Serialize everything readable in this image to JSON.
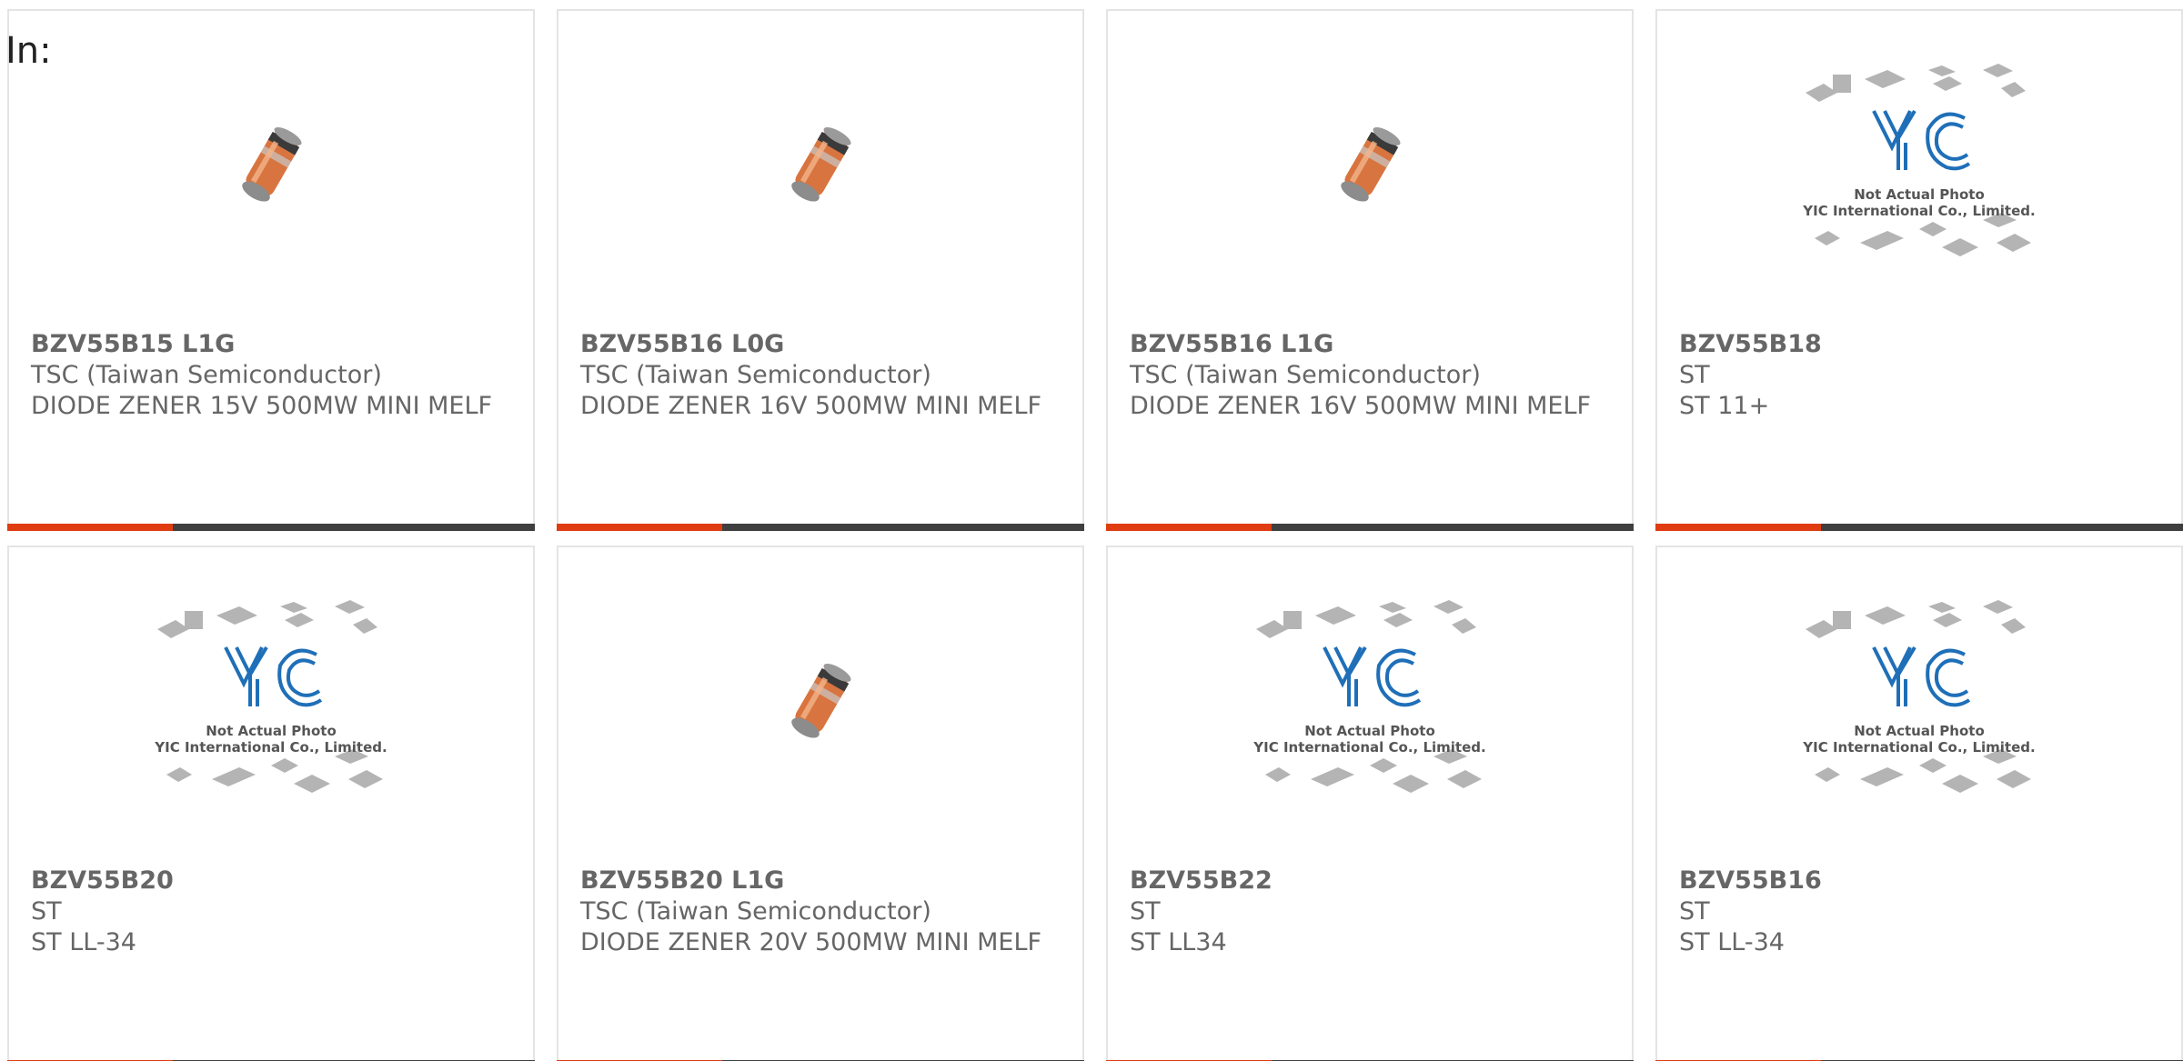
{
  "header": {
    "in_label": "In:"
  },
  "products": [
    {
      "part": "BZV55B15 L1G",
      "maker": "TSC (Taiwan Semiconductor)",
      "desc": "DIODE ZENER 15V 500MW MINI MELF",
      "image": "minimelf-diode-photo"
    },
    {
      "part": "BZV55B16 L0G",
      "maker": "TSC (Taiwan Semiconductor)",
      "desc": "DIODE ZENER 16V 500MW MINI MELF",
      "image": "minimelf-diode-photo"
    },
    {
      "part": "BZV55B16 L1G",
      "maker": "TSC (Taiwan Semiconductor)",
      "desc": "DIODE ZENER 16V 500MW MINI MELF",
      "image": "minimelf-diode-photo"
    },
    {
      "part": "BZV55B18",
      "maker": "ST",
      "desc": "ST 11+",
      "image": "yic-placeholder"
    },
    {
      "part": "BZV55B20",
      "maker": "ST",
      "desc": "ST LL-34",
      "image": "yic-placeholder"
    },
    {
      "part": "BZV55B20 L1G",
      "maker": "TSC (Taiwan Semiconductor)",
      "desc": "DIODE ZENER 20V 500MW MINI MELF",
      "image": "minimelf-diode-photo"
    },
    {
      "part": "BZV55B22",
      "maker": "ST",
      "desc": "ST LL34",
      "image": "yic-placeholder"
    },
    {
      "part": "BZV55B16",
      "maker": "ST",
      "desc": "ST LL-34",
      "image": "yic-placeholder"
    }
  ],
  "placeholder": {
    "line1": "Not Actual Photo",
    "line2": "YIC International Co., Limited."
  },
  "colors": {
    "accent": "#e03c12",
    "bar": "#3f3f3f",
    "text": "#666666",
    "yic_blue": "#1f6fb8"
  }
}
